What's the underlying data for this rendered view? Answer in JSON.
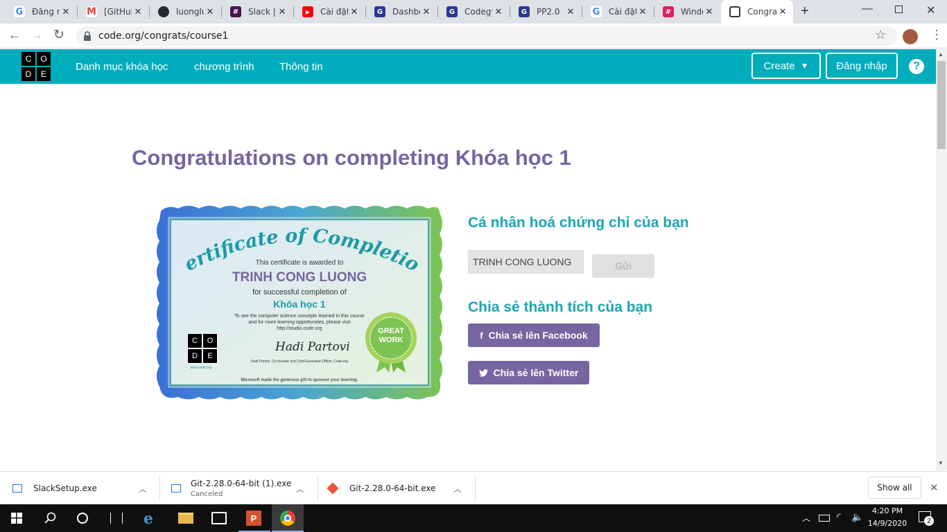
{
  "tabs": [
    {
      "title": "Đăng nh",
      "icon": "google-icon",
      "color": "#4285f4"
    },
    {
      "title": "[GitHub",
      "icon": "gmail-icon",
      "color": "#ea4335"
    },
    {
      "title": "luonglu",
      "icon": "github-icon",
      "color": "#24292e"
    },
    {
      "title": "Slack |",
      "icon": "slack-icon",
      "color": "#4a154b"
    },
    {
      "title": "Cài đặt",
      "icon": "youtube-icon",
      "color": "#ff0000"
    },
    {
      "title": "Dashbo",
      "icon": "codegym-icon",
      "color": "#2b3990"
    },
    {
      "title": "Codegy",
      "icon": "codegym-icon",
      "color": "#2b3990"
    },
    {
      "title": "PP2.0",
      "icon": "codegym-icon",
      "color": "#2b3990"
    },
    {
      "title": "Cài đặt",
      "icon": "google-icon",
      "color": "#4285f4"
    },
    {
      "title": "Windo",
      "icon": "slack-icon",
      "color": "#e01e5a"
    },
    {
      "title": "Congra",
      "icon": "code-org-icon",
      "color": "#00adbc"
    }
  ],
  "address": {
    "url": "code.org/congrats/course1"
  },
  "nav": {
    "logo": [
      "C",
      "O",
      "D",
      "E"
    ],
    "links": [
      "Danh mục khóa học",
      "chương trình",
      "Thông tin"
    ],
    "create": "Create",
    "login": "Đăng nhập",
    "help": "?"
  },
  "page": {
    "title": "Congratulations on completing Khóa học 1",
    "personalize_heading": "Cá nhân hoá chứng chỉ của bạn",
    "name_value": "TRINH CONG LUONG",
    "submit": "Gửi",
    "share_heading": "Chia sẻ thành tích của bạn",
    "facebook": "Chia sẻ lên Facebook",
    "twitter": "Chia sẻ lên Twitter"
  },
  "certificate": {
    "title": "Certificate of Completion",
    "awarded": "This certificate is awarded to",
    "name": "TRINH CONG LUONG",
    "for": "for successful completion of",
    "course": "Khóa học 1",
    "note1": "To see the computer science concepts learned in this course",
    "note2": "and for more learning opportunities, please visit",
    "note3": "http://studio.code.org",
    "signature": "Hadi Partovi",
    "signer": "Hadi Partovi, Co-founder and Chief Executive Officer, Code.org",
    "site": "www.code.org",
    "footer": "Microsoft made the generous gift to sponsor your learning.",
    "badge1": "GREAT",
    "badge2": "WORK"
  },
  "downloads": [
    {
      "name": "SlackSetup.exe",
      "status": ""
    },
    {
      "name": "Git-2.28.0-64-bit (1).exe",
      "status": "Canceled"
    },
    {
      "name": "Git-2.28.0-64-bit.exe",
      "status": ""
    }
  ],
  "show_all": "Show all",
  "taskbar": {
    "time": "4:20 PM",
    "date": "14/9/2020",
    "notifications": "2"
  }
}
